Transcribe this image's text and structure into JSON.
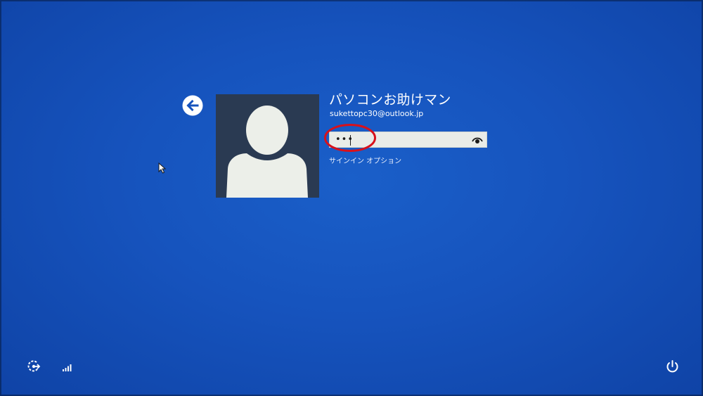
{
  "account": {
    "display_name": "パソコンお助けマン",
    "email": "sukettopc30@outlook.jp",
    "avatar_icon": "default-user-silhouette-icon"
  },
  "password": {
    "masked_value": "•••",
    "reveal_icon": "eye-icon"
  },
  "signin_options_label": "サインイン オプション",
  "icons": {
    "back": "back-arrow-icon",
    "ease_of_access": "ease-of-access-icon",
    "network": "network-signal-icon",
    "power": "power-icon"
  },
  "colors": {
    "background": "#1653bd",
    "avatar_background": "#2a3a52",
    "highlight_annotation": "#d8111b",
    "field_background": "#e9ece8"
  }
}
